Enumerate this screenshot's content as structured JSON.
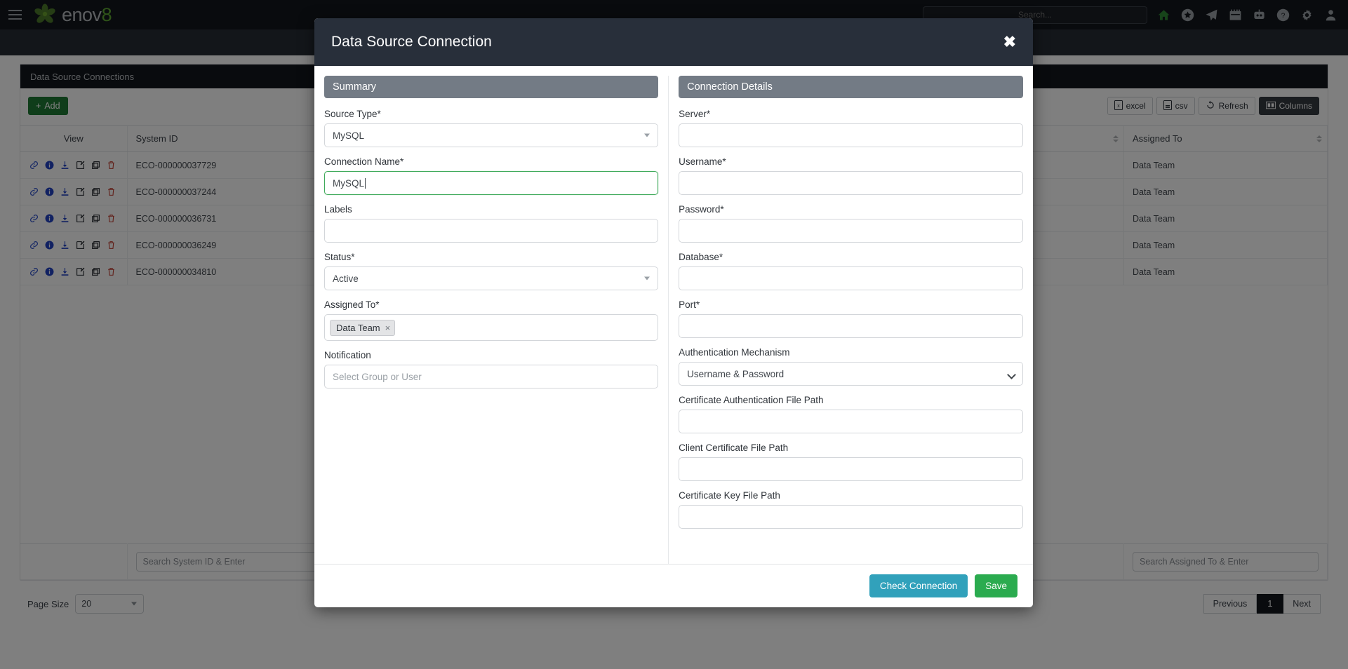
{
  "navbar": {
    "menu_icon": "hamburger-icon",
    "brand": "enov",
    "brand_accent": "8",
    "search_placeholder": "Search...",
    "search_value": "",
    "icons": [
      {
        "name": "home-icon",
        "color": "#2f8a35"
      },
      {
        "name": "star-icon",
        "color": "#9aa0a6"
      },
      {
        "name": "paper-plane-icon",
        "color": "#9aa0a6"
      },
      {
        "name": "calendar-icon",
        "color": "#9aa0a6"
      },
      {
        "name": "robot-icon",
        "color": "#9aa0a6"
      },
      {
        "name": "help-icon",
        "color": "#9aa0a6"
      },
      {
        "name": "gear-icon",
        "color": "#9aa0a6"
      },
      {
        "name": "user-icon",
        "color": "#9aa0a6"
      }
    ]
  },
  "panel": {
    "title": "Data Source Connections",
    "add_label": "Add",
    "export": [
      {
        "name": "excel-export-button",
        "label": "excel",
        "icon": "excel-file-icon",
        "style": "light"
      },
      {
        "name": "csv-export-button",
        "label": "csv",
        "icon": "csv-file-icon",
        "style": "light"
      },
      {
        "name": "refresh-button",
        "label": "Refresh",
        "icon": "refresh-icon",
        "style": "light"
      },
      {
        "name": "columns-button",
        "label": "Columns",
        "icon": "columns-icon",
        "style": "dark"
      }
    ]
  },
  "table": {
    "columns": [
      {
        "key": "view",
        "label": "View",
        "sortable": false
      },
      {
        "key": "system_id",
        "label": "System ID",
        "sortable": true
      },
      {
        "key": "spacer",
        "label": "",
        "sortable": true
      },
      {
        "key": "assigned_to",
        "label": "Assigned To",
        "sortable": true
      }
    ],
    "row_icons": [
      {
        "name": "link-icon",
        "color": "#3355cc"
      },
      {
        "name": "info-icon",
        "color": "#2242c4"
      },
      {
        "name": "download-icon",
        "color": "#2242c4"
      },
      {
        "name": "edit-icon",
        "color": "#1b1f25"
      },
      {
        "name": "copy-icon",
        "color": "#1b1f25"
      },
      {
        "name": "delete-icon",
        "color": "#c0392b"
      }
    ],
    "rows": [
      {
        "system_id": "ECO-000000037729",
        "assigned_to": "Data Team"
      },
      {
        "system_id": "ECO-000000037244",
        "assigned_to": "Data Team"
      },
      {
        "system_id": "ECO-000000036731",
        "assigned_to": "Data Team"
      },
      {
        "system_id": "ECO-000000036249",
        "assigned_to": "Data Team"
      },
      {
        "system_id": "ECO-000000034810",
        "assigned_to": "Data Team"
      }
    ],
    "search": {
      "system_id_placeholder": "Search System ID & Enter",
      "system_id_value": "",
      "assigned_to_placeholder": "Search Assigned To & Enter",
      "assigned_to_value": ""
    }
  },
  "footer": {
    "page_size_label": "Page Size",
    "page_size_value": "20",
    "previous_label": "Previous",
    "current_page": "1",
    "next_label": "Next"
  },
  "modal": {
    "title": "Data Source Connection",
    "close_glyph": "✖",
    "summary": {
      "section_title": "Summary",
      "fields": {
        "source_type": {
          "label": "Source Type*",
          "value": "MySQL",
          "control": "select"
        },
        "connection_name": {
          "label": "Connection Name*",
          "value": "MySQL",
          "control": "input",
          "focused": true
        },
        "labels": {
          "label": "Labels",
          "value": "",
          "control": "input"
        },
        "status": {
          "label": "Status*",
          "value": "Active",
          "control": "select"
        },
        "assigned_to": {
          "label": "Assigned To*",
          "control": "tags",
          "tags": [
            "Data Team"
          ],
          "tag_remove_glyph": "×"
        },
        "notification": {
          "label": "Notification",
          "value": "",
          "placeholder": "Select Group or User",
          "control": "input"
        }
      }
    },
    "connection_details": {
      "section_title": "Connection Details",
      "fields": {
        "server": {
          "label": "Server*",
          "value": "",
          "control": "input"
        },
        "username": {
          "label": "Username*",
          "value": "",
          "control": "input"
        },
        "password": {
          "label": "Password*",
          "value": "",
          "control": "input"
        },
        "database": {
          "label": "Database*",
          "value": "",
          "control": "input"
        },
        "port": {
          "label": "Port*",
          "value": "",
          "control": "input"
        },
        "auth_mechanism": {
          "label": "Authentication Mechanism",
          "value": "Username & Password",
          "control": "select"
        },
        "cert_auth_path": {
          "label": "Certificate Authentication File Path",
          "value": "",
          "control": "input"
        },
        "client_cert_path": {
          "label": "Client Certificate File Path",
          "value": "",
          "control": "input"
        },
        "cert_key_path": {
          "label": "Certificate Key File Path",
          "value": "",
          "control": "input"
        }
      }
    },
    "buttons": {
      "check_connection": "Check Connection",
      "save": "Save"
    },
    "colors": {
      "header_bg": "#282f3a",
      "section_bg": "#737b85",
      "check_button": "#31a1bb",
      "save_button": "#2bab4f",
      "focus_border": "#3faa5a"
    }
  }
}
